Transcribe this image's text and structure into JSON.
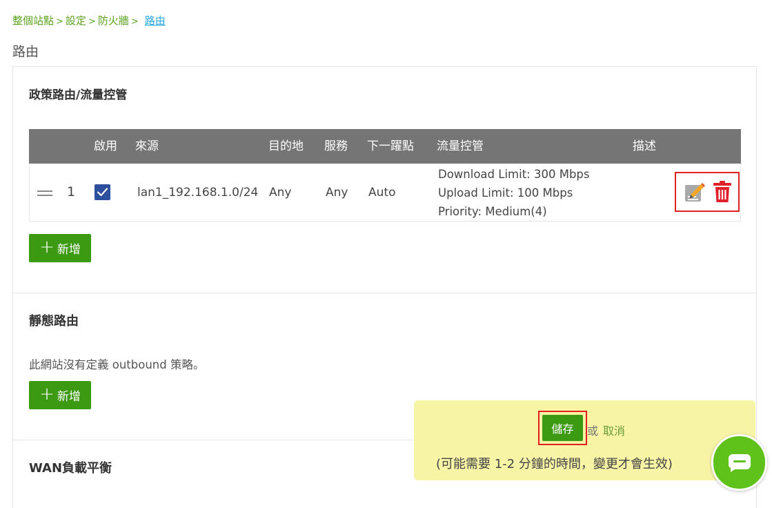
{
  "breadcrumb": {
    "items": [
      "整個站點",
      "設定",
      "防火牆"
    ],
    "separator": ">",
    "current": "路由"
  },
  "page_title": "路由",
  "policy_routing": {
    "title": "政策路由/流量控管",
    "columns": [
      "啟用",
      "來源",
      "目的地",
      "服務",
      "下一躍點",
      "流量控管",
      "描述"
    ],
    "rows": [
      {
        "index": "1",
        "enabled": true,
        "source": "lan1_192.168.1.0/24",
        "destination": "Any",
        "service": "Any",
        "next_hop": "Auto",
        "traffic_control": [
          "Download Limit: 300 Mbps",
          "Upload Limit: 100 Mbps",
          "Priority: Medium(4)"
        ],
        "description": ""
      }
    ],
    "add_label": "新增"
  },
  "static_routing": {
    "title": "靜態路由",
    "empty_text": "此網站沒有定義 outbound 策略。",
    "add_label": "新增"
  },
  "wan_lb": {
    "title": "WAN負載平衡"
  },
  "save_bar": {
    "save_label": "儲存",
    "or_text": "或",
    "cancel_label": "取消",
    "notice": "(可能需要 1-2 分鐘的時間，變更才會生效)"
  },
  "icons": {
    "edit": "edit-pencil-icon",
    "delete": "trash-icon",
    "chat": "chat-bubble-icon",
    "drag": "drag-handle-icon",
    "check": "checkmark-icon"
  },
  "colors": {
    "accent_green": "#3c9a12",
    "breadcrumb_green": "#5aa320",
    "link_blue": "#29a8e0",
    "header_gray": "#757575",
    "checkbox_blue": "#2c4f9e",
    "delete_red": "#e0202a",
    "save_bar_bg": "#f8f4a6",
    "chat_green": "#5ec21a"
  }
}
